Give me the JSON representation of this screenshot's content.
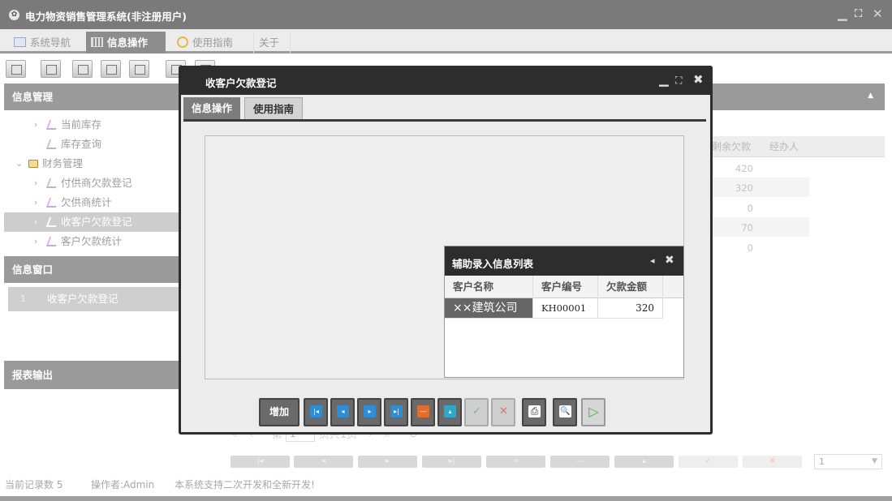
{
  "window": {
    "title": "电力物资销售管理系统(非注册用户)",
    "controls": {
      "minimize": "▁",
      "restore": "⛶",
      "close": "✕"
    }
  },
  "menubar": {
    "tabs": [
      {
        "label": "系统导航",
        "icon": "monitor-icon",
        "active": false
      },
      {
        "label": "信息操作",
        "icon": "grid-icon",
        "active": true
      },
      {
        "label": "使用指南",
        "icon": "help-circle-icon",
        "active": false
      },
      {
        "label": "关于",
        "icon": "",
        "active": false
      }
    ]
  },
  "toolbar": {
    "buttons": [
      "search-icon",
      "list-icon",
      "document-icon",
      "user-card-icon",
      "image-icon",
      "export-icon",
      "print-icon"
    ]
  },
  "left_panel": {
    "info_mgmt_title": "信息管理",
    "tree": [
      {
        "label": "当前库存",
        "icon": "tool-icon",
        "arrow": "›",
        "level": 2,
        "selected": false
      },
      {
        "label": "库存查询",
        "icon": "tool-icon",
        "arrow": "",
        "level": 2,
        "selected": false
      },
      {
        "label": "财务管理",
        "icon": "folder-icon",
        "arrow": "⌄",
        "level": 1,
        "selected": false
      },
      {
        "label": "付供商欠款登记",
        "icon": "tool-icon",
        "arrow": "›",
        "level": 2,
        "selected": false
      },
      {
        "label": "欠供商统计",
        "icon": "tool-icon",
        "arrow": "›",
        "level": 2,
        "selected": false
      },
      {
        "label": "收客户欠款登记",
        "icon": "tool-icon",
        "arrow": "›",
        "level": 2,
        "selected": true
      },
      {
        "label": "客户欠款统计",
        "icon": "tool-icon",
        "arrow": "›",
        "level": 2,
        "selected": false
      }
    ],
    "info_window_title": "信息窗口",
    "open_windows": [
      {
        "index": "1",
        "label": "收客户欠款登记"
      }
    ],
    "report_title": "报表输出"
  },
  "background_grid": {
    "columns": [
      "剩余欠款",
      "经办人"
    ],
    "rows": [
      "420",
      "320",
      "0",
      "70",
      "0"
    ],
    "pager": {
      "first": "«",
      "prev": "‹",
      "page_prefix": "第",
      "page_value": "1",
      "page_suffix": "页共1页",
      "next": "›",
      "last": "»",
      "refresh": "↻"
    },
    "page_size": "1"
  },
  "statusbar": {
    "records": "当前记录数 5",
    "operator": "操作者:Admin",
    "note": "本系统支持二次开发和全新开发!"
  },
  "modal": {
    "title": "收客户欠款登记",
    "controls": {
      "minimize": "▁",
      "maximize": "⛶",
      "close": "✖"
    },
    "tabs": [
      {
        "label": "信息操作",
        "active": true
      },
      {
        "label": "使用指南",
        "active": false
      }
    ],
    "aux_list": {
      "title": "辅助录入信息列表",
      "controls": {
        "collapse": "◂",
        "close": "✖"
      },
      "columns": [
        "客户名称",
        "客户编号",
        "欠款金额"
      ],
      "rows": [
        {
          "name": "××建筑公司",
          "code": "KH00001",
          "amount": "320"
        }
      ]
    },
    "buttons": {
      "add": "增加",
      "nav": [
        {
          "name": "first-record-button",
          "glyph": "|◂",
          "disabled": false
        },
        {
          "name": "prev-record-button",
          "glyph": "◂",
          "disabled": false
        },
        {
          "name": "next-record-button",
          "glyph": "▸",
          "disabled": false
        },
        {
          "name": "last-record-button",
          "glyph": "▸|",
          "disabled": false
        },
        {
          "name": "delete-button",
          "glyph": "—",
          "disabled": false
        },
        {
          "name": "edit-button",
          "glyph": "▴",
          "disabled": false
        },
        {
          "name": "confirm-button",
          "glyph": "✓",
          "disabled": true
        },
        {
          "name": "cancel-button",
          "glyph": "✕",
          "disabled": true
        },
        {
          "name": "print-button",
          "glyph": "⎙",
          "disabled": false
        },
        {
          "name": "preview-button",
          "glyph": "🔍",
          "disabled": false
        },
        {
          "name": "run-button",
          "glyph": "▷",
          "disabled": false
        }
      ]
    }
  }
}
